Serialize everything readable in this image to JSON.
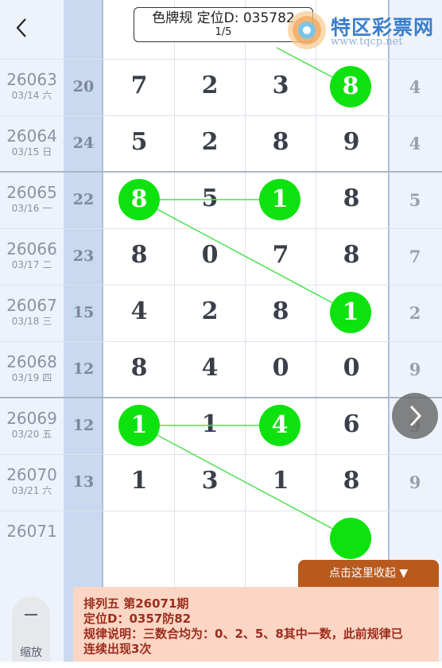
{
  "header": {
    "title_line1": "色牌规 定位D: 035782",
    "title_line2": "1/5",
    "brand_name": "特区彩票网",
    "brand_url": "www.tqcp.net"
  },
  "rows": [
    {
      "issue": "26063",
      "date": "03/14 六",
      "sum": "20",
      "digits": [
        "7",
        "2",
        "3",
        "8"
      ],
      "right": "4"
    },
    {
      "issue": "26064",
      "date": "03/15 日",
      "sum": "24",
      "digits": [
        "5",
        "2",
        "8",
        "9"
      ],
      "right": "4"
    },
    {
      "issue": "26065",
      "date": "03/16 一",
      "sum": "22",
      "digits": [
        "8",
        "5",
        "1",
        "8"
      ],
      "right": "5"
    },
    {
      "issue": "26066",
      "date": "03/17 二",
      "sum": "23",
      "digits": [
        "8",
        "0",
        "7",
        "8"
      ],
      "right": "7"
    },
    {
      "issue": "26067",
      "date": "03/18 三",
      "sum": "15",
      "digits": [
        "4",
        "2",
        "8",
        "1"
      ],
      "right": "2"
    },
    {
      "issue": "26068",
      "date": "03/19 四",
      "sum": "12",
      "digits": [
        "8",
        "4",
        "0",
        "0"
      ],
      "right": "9"
    },
    {
      "issue": "26069",
      "date": "03/20 五",
      "sum": "12",
      "digits": [
        "1",
        "1",
        "4",
        "6"
      ],
      "right": "9"
    },
    {
      "issue": "26070",
      "date": "03/21 六",
      "sum": "13",
      "digits": [
        "1",
        "3",
        "1",
        "8"
      ],
      "right": "9"
    },
    {
      "issue": "26071",
      "date": "",
      "sum": "",
      "digits": [
        "",
        "",
        "",
        ""
      ],
      "right": ""
    }
  ],
  "highlights": [
    {
      "row": 0,
      "col": 3
    },
    {
      "row": 2,
      "col": 0
    },
    {
      "row": 2,
      "col": 2
    },
    {
      "row": 4,
      "col": 3
    },
    {
      "row": 6,
      "col": 0
    },
    {
      "row": 6,
      "col": 2
    },
    {
      "row": 8,
      "col": 3
    }
  ],
  "collapse_label": "点击这里收起 ▼",
  "info": {
    "line1": "排列五 第26071期",
    "line2": "定位D：0357防82",
    "line3": "规律说明：三数合均为：0、2、5、8其中一数，此前规律已",
    "line4": "连续出现3次"
  },
  "zoom_label": "缩放",
  "colors": {
    "ball": "#0ee20e",
    "panel": "#fcd6c4",
    "tab": "#b85a1e",
    "panel_text": "#9b2d1d"
  }
}
